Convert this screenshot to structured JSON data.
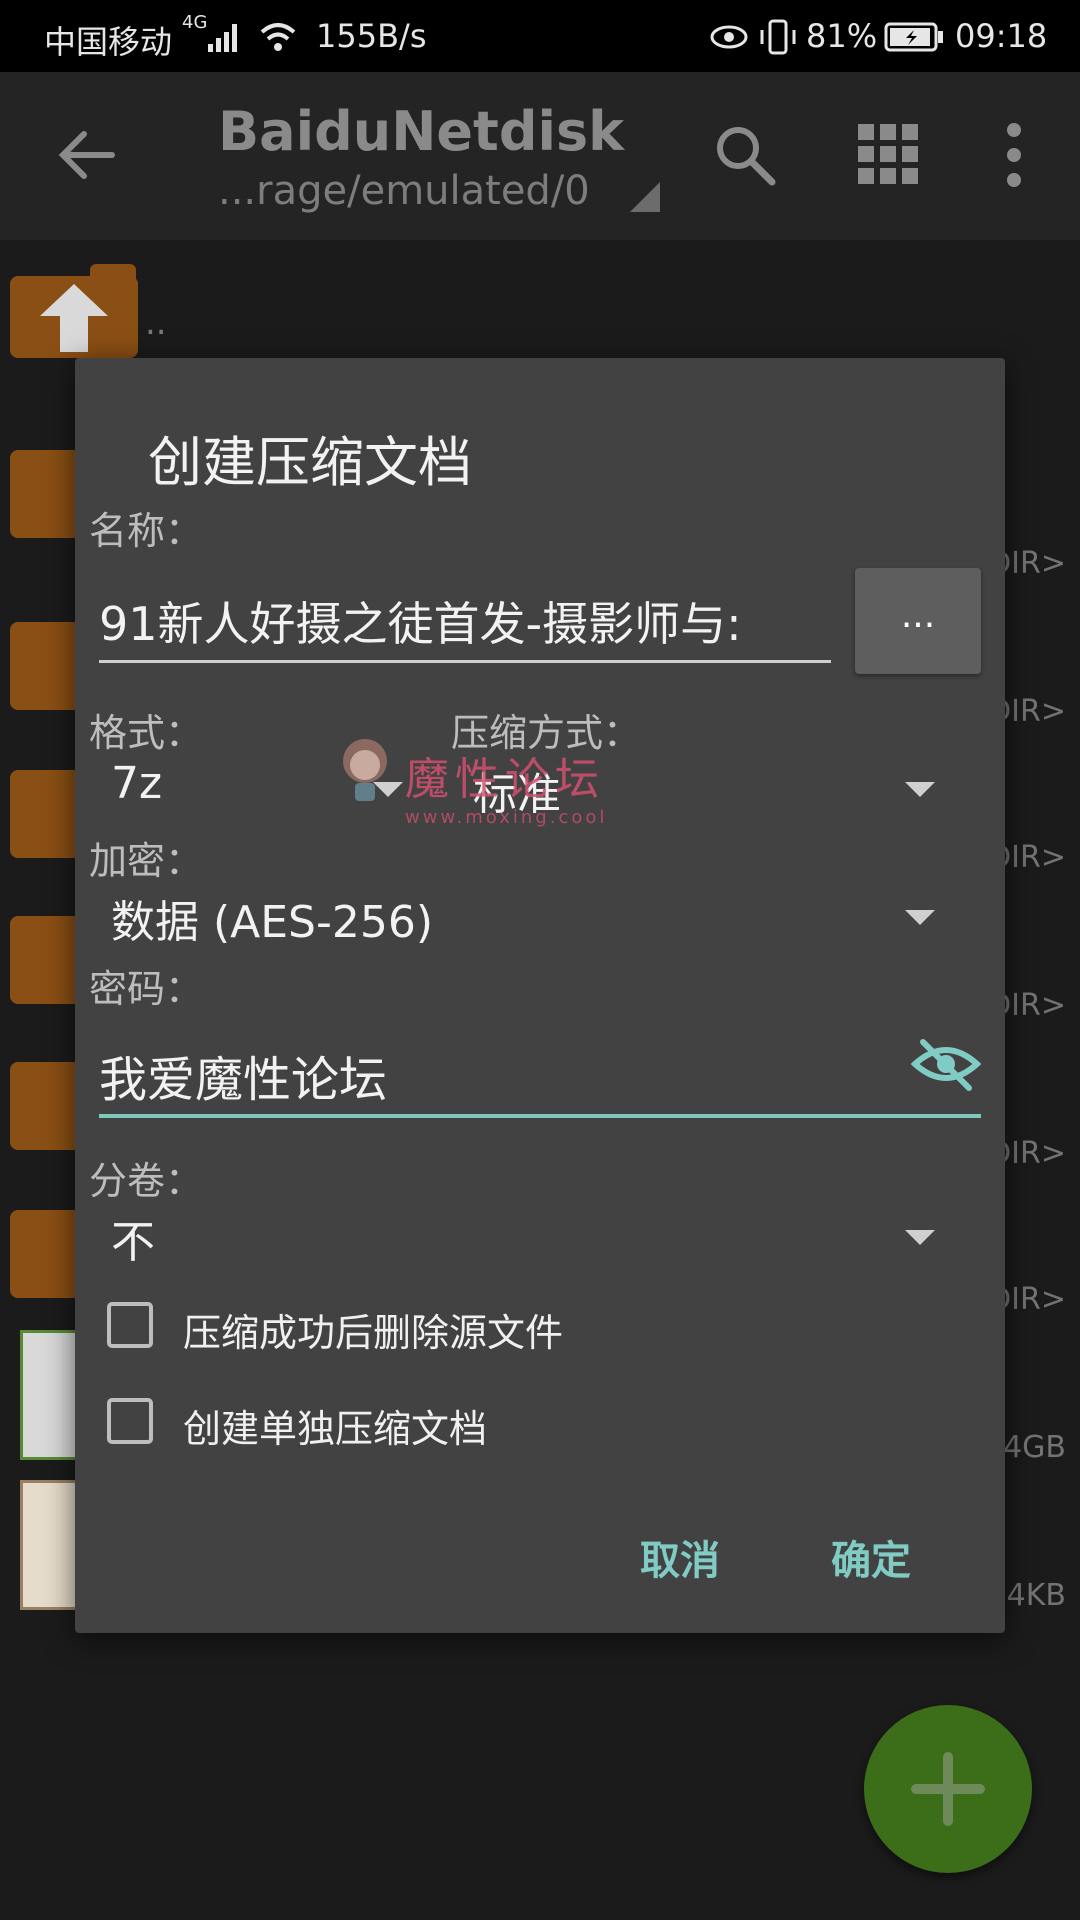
{
  "status_bar": {
    "carrier": "中国移动",
    "network": "4G",
    "speed": "155B/s",
    "battery": "81%",
    "time": "09:18"
  },
  "app_bar": {
    "title": "BaiduNetdisk",
    "path": "...rage/emulated/0",
    "icons": [
      "back-arrow-icon",
      "search-icon",
      "grid-icon",
      "more-vert-icon"
    ]
  },
  "file_list": {
    "parent_label": "..",
    "right_labels": [
      "DIR>",
      "DIR>",
      "DIR>",
      "DIR>",
      "DIR>",
      "DIR>",
      "4GB",
      "4KB"
    ]
  },
  "dialog": {
    "title": "创建压缩文档",
    "name_label": "名称：",
    "name_value": "91新人好摄之徒首发-摄影师与:",
    "browse_label": "...",
    "format_label": "格式：",
    "format_value": "7z",
    "compression_label": "压缩方式：",
    "compression_value": "标准",
    "encryption_label": "加密：",
    "encryption_value": "数据 (AES-256)",
    "password_label": "密码：",
    "password_value": "我爱魔性论坛",
    "split_label": "分卷：",
    "split_value": "不",
    "checkbox_delete_label": "压缩成功后删除源文件",
    "checkbox_delete_checked": false,
    "checkbox_separate_label": "创建单独压缩文档",
    "checkbox_separate_checked": false,
    "cancel_label": "取消",
    "ok_label": "确定"
  },
  "watermark": {
    "text": "魔性论坛",
    "url": "www.moxing.cool"
  },
  "colors": {
    "accent": "#80cbc4",
    "dialog_bg": "#424242",
    "fab": "#3c6e1a",
    "folder": "#8a4f14"
  }
}
